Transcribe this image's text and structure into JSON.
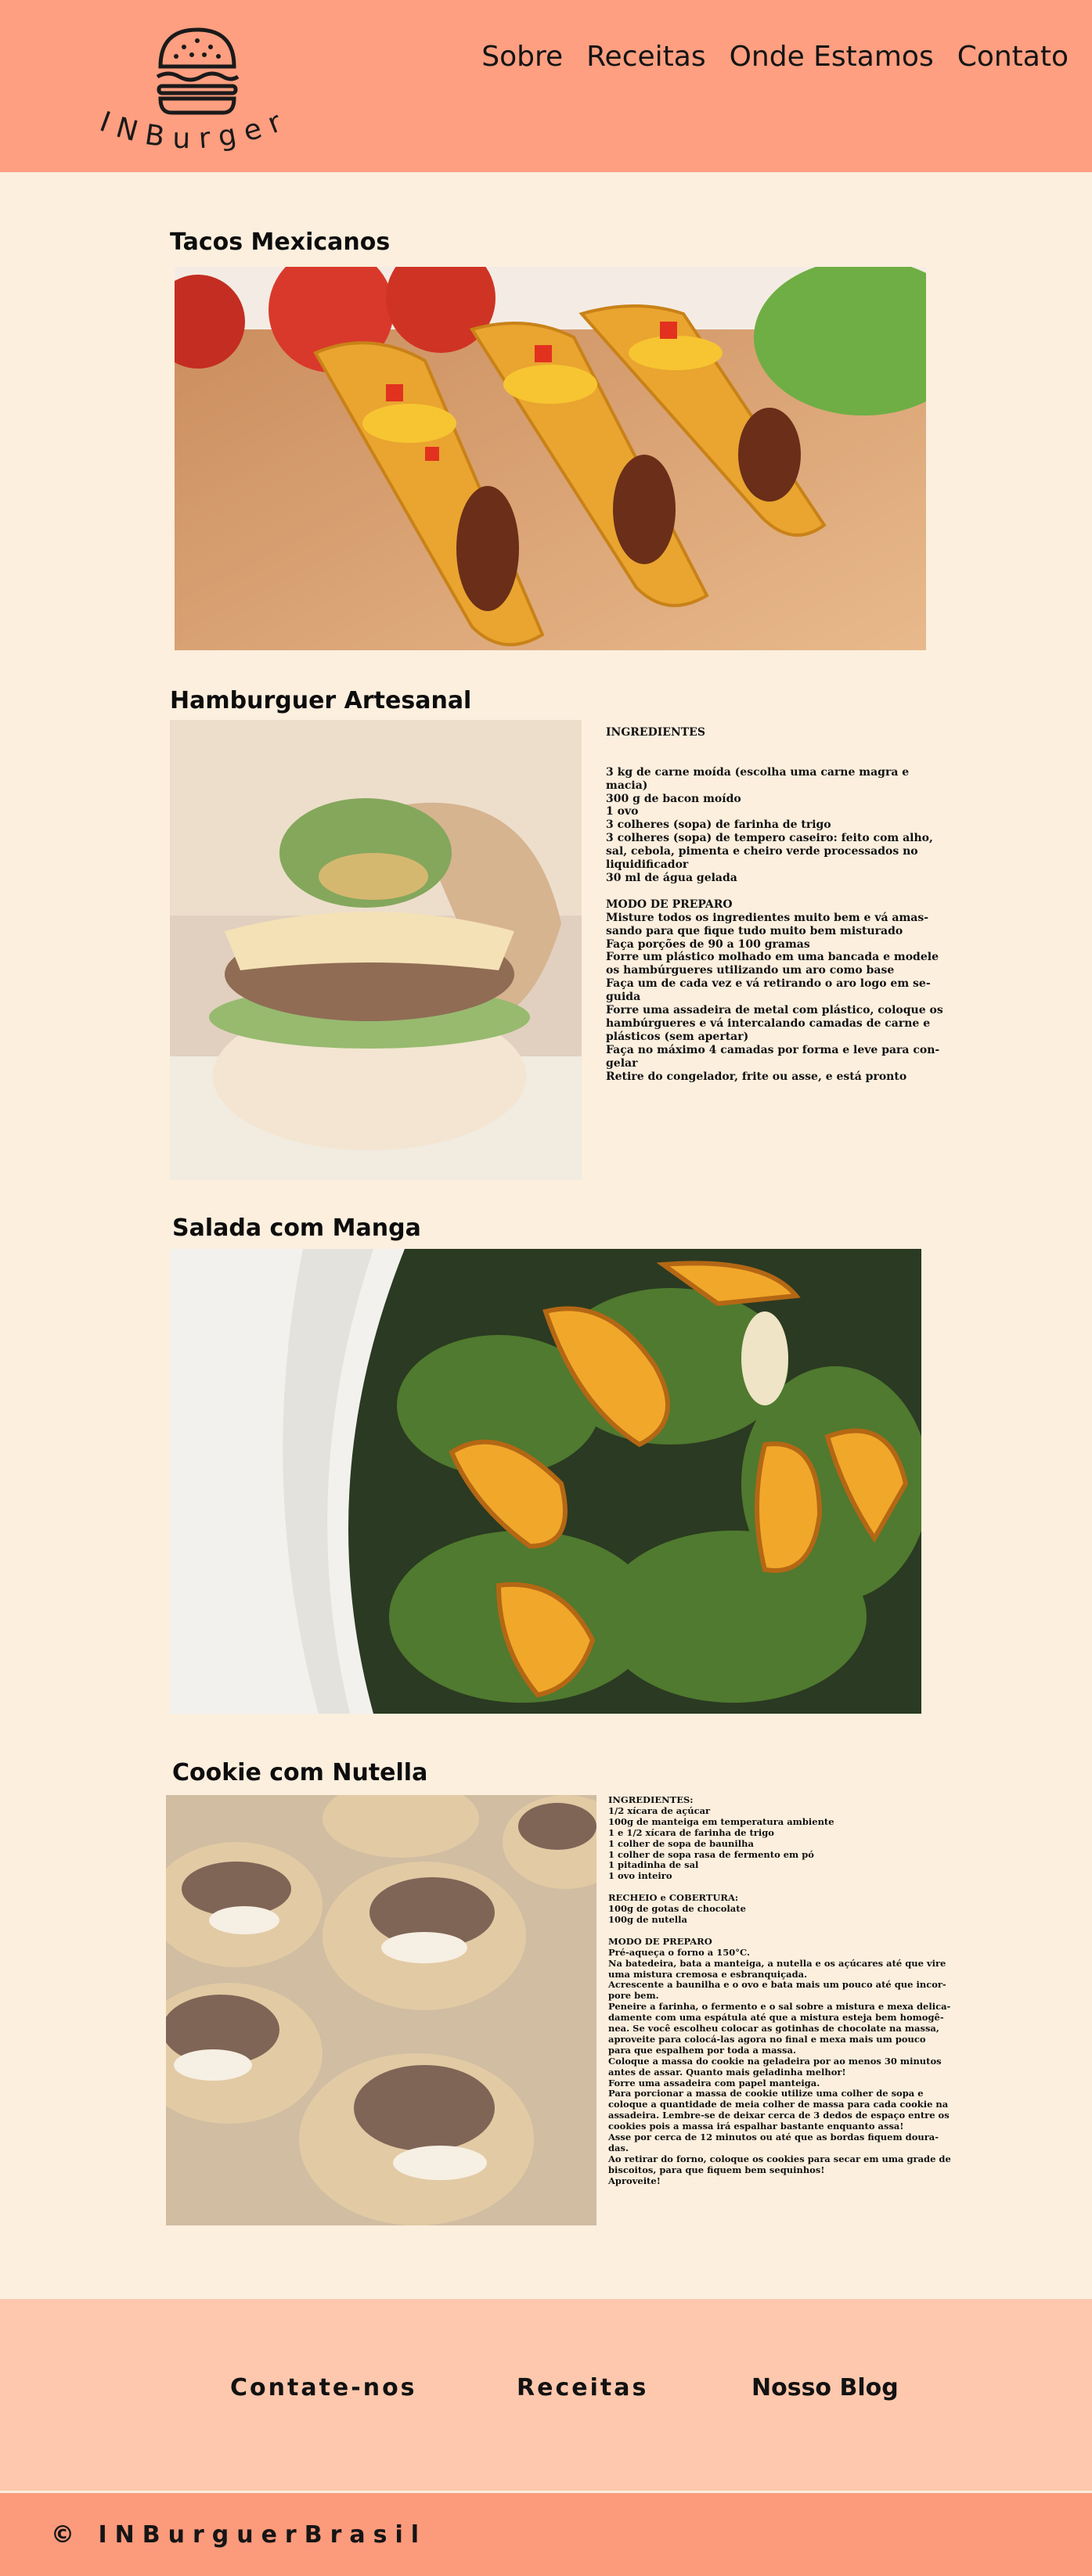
{
  "brand": {
    "logo_text": "INBurger"
  },
  "nav": {
    "items": [
      "Sobre",
      "Receitas",
      "Onde Estamos",
      "Contato"
    ]
  },
  "recipes": {
    "tacos": {
      "title": "Tacos   Mexicanos"
    },
    "hamburger": {
      "title": "Hamburguer  Artesanal",
      "text": [
        "INGREDIENTES",
        "",
        "",
        "3 kg de carne moída (escolha uma carne magra e",
        "macia)",
        "300 g de bacon moído",
        "1 ovo",
        "3 colheres (sopa) de farinha de trigo",
        "3 colheres (sopa) de tempero caseiro: feito com alho,",
        "sal, cebola, pimenta e cheiro verde processados no",
        "liquidificador",
        "30 ml de água gelada",
        "",
        " MODO DE PREPARO",
        "Misture todos os ingredientes muito bem e vá amas-",
        "sando para que fique tudo muito bem misturado",
        "Faça porções de 90 a 100 gramas",
        "Forre um plástico molhado em uma bancada e modele",
        "os hambúrgueres utilizando um aro como base",
        "Faça um de cada vez e vá retirando o aro logo em se-",
        "guida",
        "Forre uma assadeira de metal com plástico, coloque os",
        "hambúrgueres e vá intercalando camadas de carne e",
        "plásticos (sem apertar)",
        "Faça no máximo 4 camadas por forma e leve para con-",
        "gelar",
        "Retire do congelador, frite ou asse, e está pronto"
      ]
    },
    "salada": {
      "title": "Salada  com Manga"
    },
    "cookie": {
      "title": "Cookie com Nutella",
      "text": [
        "INGREDIENTES:",
        "1/2 xícara de açúcar",
        "100g de manteiga em temperatura ambiente",
        "1 e 1/2 xícara de farinha de trigo",
        "1 colher de sopa de baunilha",
        "1 colher de sopa rasa de fermento em pó",
        "1 pitadinha de sal",
        "1 ovo inteiro",
        "",
        "RECHEIO e COBERTURA:",
        "100g de gotas de chocolate",
        "100g  de nutella",
        "",
        "MODO DE PREPARO",
        "Pré-aqueça o forno a 150°C.",
        "Na batedeira, bata a manteiga, a nutella e os açúcares até que vire",
        "uma mistura cremosa e esbranquiçada.",
        "Acrescente a baunilha e o ovo e bata mais um pouco até que incor-",
        "pore bem.",
        "Peneire a farinha, o fermento e o sal sobre a mistura e mexa delica-",
        "damente com uma espátula até que a mistura esteja bem homogê-",
        "nea. Se você escolheu colocar as gotinhas de chocolate na massa,",
        "aproveite para colocá-las agora no final e mexa mais um pouco",
        "para que espalhem por toda a massa.",
        "Coloque a massa do cookie na geladeira por ao menos 30 minutos",
        "antes de assar. Quanto mais geladinha melhor!",
        "Forre uma assadeira com papel manteiga.",
        "Para porcionar a massa de cookie utilize uma colher de sopa e",
        "coloque a quantidade de meia colher de massa para cada cookie na",
        "assadeira. Lembre-se de deixar cerca de 3 dedos de espaço entre os",
        "cookies pois a massa irá espalhar bastante enquanto assa!",
        "Asse por cerca de 12 minutos ou até que as bordas fiquem doura-",
        "das.",
        "Ao retirar do forno, coloque os cookies para secar em uma grade de",
        "biscoitos, para que fiquem bem sequinhos!",
        "Aproveite!"
      ]
    }
  },
  "footer": {
    "links": [
      "Contate-nos",
      "Receitas",
      "Nosso Blog"
    ]
  },
  "copyright": "© INBurguerBrasil",
  "colors": {
    "header": "#fd9f80",
    "page": "#fcefde",
    "footer": "#fdc8ad",
    "copyright_bar": "#fc9a7c"
  },
  "icons": [
    "burger-icon"
  ]
}
